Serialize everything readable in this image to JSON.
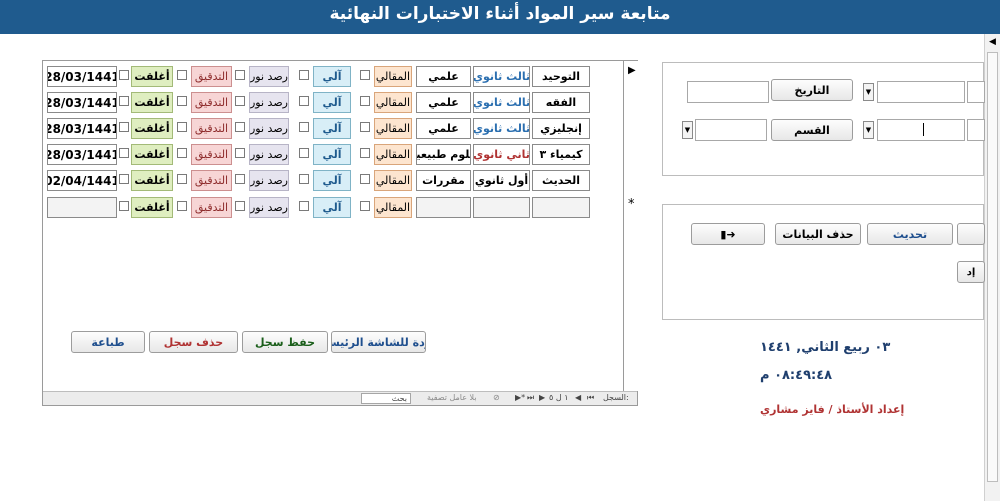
{
  "window": {
    "title": "متابعة سير المواد أثناء الاختبارات النهائية"
  },
  "rows": [
    {
      "subject": "التوحيد",
      "grade": "ثالث ثانوي",
      "track": "علمي",
      "essay": "المقالي",
      "auto": "آلي",
      "rasd": "رصد نور",
      "tadqeeq": "التدقيق",
      "closed": "أغلقت",
      "date": "28/03/1441"
    },
    {
      "subject": "الفقه",
      "grade": "ثالث ثانوي",
      "track": "علمي",
      "essay": "المقالي",
      "auto": "آلي",
      "rasd": "رصد نور",
      "tadqeeq": "التدقيق",
      "closed": "أغلقت",
      "date": "28/03/1441"
    },
    {
      "subject": "إنجليزي",
      "grade": "ثالث ثانوي",
      "track": "علمي",
      "essay": "المقالي",
      "auto": "آلي",
      "rasd": "رصد نور",
      "tadqeeq": "التدقيق",
      "closed": "أغلقت",
      "date": "28/03/1441"
    },
    {
      "subject": "كيمياء ٣",
      "grade": "ثاني ثانوي",
      "track": "علوم طبيعية",
      "essay": "المقالي",
      "auto": "آلي",
      "rasd": "رصد نور",
      "tadqeeq": "التدقيق",
      "closed": "أغلقت",
      "date": "28/03/1441"
    },
    {
      "subject": "الحديث",
      "grade": "أول ثانوي",
      "track": "مقررات",
      "essay": "المقالي",
      "auto": "آلي",
      "rasd": "رصد نور",
      "tadqeeq": "التدقيق",
      "closed": "أغلقت",
      "date": "02/04/1441"
    }
  ],
  "new_row": {
    "marker": "*",
    "essay": "المقالي",
    "auto": "آلي",
    "rasd": "رصد نور",
    "tadqeeq": "التدقيق",
    "closed": "أغلقت"
  },
  "buttons": {
    "home": "عودة للشاشة الرئيسية",
    "save": "حفظ سجل",
    "delete_record": "حذف سجل",
    "print": "طباعة"
  },
  "record_nav": {
    "label": "السجل:",
    "position": "١ ل ٥",
    "no_filter": "بلا عامل تصفية",
    "search": "بحث"
  },
  "filters": {
    "date_label": "التاريخ",
    "section_label": "القسم"
  },
  "actions": {
    "update": "تحديث",
    "delete_data": "حذف البيانات",
    "partial": "إد"
  },
  "info": {
    "hijri_date": "٠٣ ربيع الثاني, ١٤٤١",
    "time": "٠٨:٤٩:٤٨ م",
    "credit": "إعداد الأستاذ / فايز مشاري"
  },
  "colors": {
    "titlebar": "#1f5b8e",
    "grade_blue": "#2b6fb0",
    "grade_red": "#b03333",
    "save_green": "#1a5e1a",
    "delete_red": "#b03333",
    "update_blue": "#1f4f8e"
  },
  "icons": {
    "exit": "exit-door-icon",
    "scroll_up": "scroll-up-arrow-icon",
    "record_pointer": "record-pointer-icon"
  }
}
